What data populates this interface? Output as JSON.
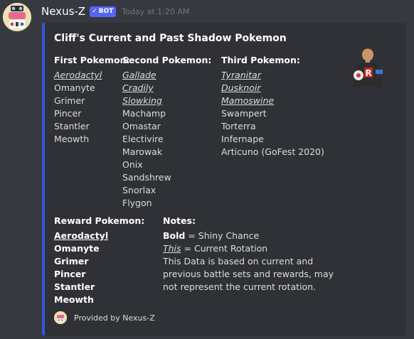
{
  "header": {
    "username": "Nexus-Z",
    "bot_tag": "BOT",
    "timestamp": "Today at 1:20 AM"
  },
  "embed": {
    "title": "Cliff's Current and Past Shadow Pokemon",
    "accent_color": "#3457db",
    "fields": {
      "first": {
        "name": "First Pokemon:",
        "items": [
          "Aerodactyl",
          "Omanyte",
          "Grimer",
          "Pincer",
          "Stantler",
          "Meowth"
        ]
      },
      "second": {
        "name": "Second Pokemon:",
        "items": [
          "Gallade",
          "Cradily",
          "Slowking",
          "Machamp",
          "Omastar",
          "Electivire",
          "Marowak",
          "Onix",
          "Sandshrew",
          "Snorlax",
          "Flygon"
        ]
      },
      "third": {
        "name": "Third Pokemon:",
        "items": [
          "Tyranitar",
          "Dusknoir",
          "Mamoswine",
          "Swampert",
          "Torterra",
          "Infernape",
          "Articuno (GoFest 2020)"
        ]
      },
      "reward": {
        "name": "Reward Pokemon:",
        "items": [
          "Aerodactyl",
          "Omanyte",
          "Grimer",
          "Pincer",
          "Stantler",
          "Meowth"
        ]
      },
      "notes": {
        "name": "Notes:",
        "bold_word": "Bold",
        "bold_desc": " = Shiny Chance",
        "this_word": "This",
        "this_desc": " = Current Rotation",
        "line3": "This Data is based on current and",
        "line4": "previous battle sets and rewards, may",
        "line5": "not represent the current rotation."
      }
    },
    "footer": {
      "text": "Provided by Nexus-Z"
    }
  }
}
